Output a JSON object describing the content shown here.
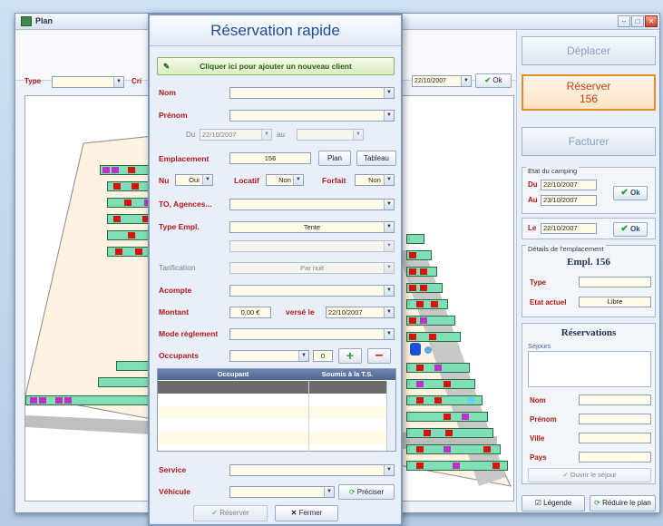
{
  "window": {
    "title": "Plan"
  },
  "toolbar": {
    "type_label": "Type",
    "crit_label": "Cri",
    "date_value": "22/10/2007",
    "ok_label": "Ok"
  },
  "right_panel": {
    "deplacer": "Déplacer",
    "reserver_line1": "Réserver",
    "reserver_line2": "156",
    "facturer": "Facturer",
    "etat_title": "Etat du camping",
    "du_label": "Du",
    "du_value": "22/10/2007",
    "au_label": "Au",
    "au_value": "23/10/2007",
    "ok_label": "Ok",
    "le_label": "Le",
    "le_value": "22/10/2007",
    "details_title": "Détails de l'emplacement",
    "empl_title": "Empl. 156",
    "type_label": "Type",
    "etat_actuel_label": "Etat actuel",
    "etat_actuel_value": "Libre",
    "reservations_title": "Réservations",
    "sejours_label": "Séjours",
    "nom_label": "Nom",
    "prenom_label": "Prénom",
    "ville_label": "Ville",
    "pays_label": "Pays",
    "ouvrir_sejour": "Ouvrir le séjour",
    "legende": "Légende",
    "reduire_plan": "Réduire le plan"
  },
  "dialog": {
    "title": "Réservation rapide",
    "add_client": "Cliquer ici pour ajouter un nouveau client",
    "nom_label": "Nom",
    "prenom_label": "Prénom",
    "du_label": "Du",
    "du_value": "22/10/2007",
    "au_label": "au",
    "emplacement_label": "Emplacement",
    "emplacement_value": "156",
    "plan_btn": "Plan",
    "tableau_btn": "Tableau",
    "nu_label": "Nu",
    "nu_value": "Oui",
    "locatif_label": "Locatif",
    "locatif_value": "Non",
    "forfait_label": "Forfait",
    "forfait_value": "Non",
    "to_label": "TO, Agences...",
    "type_empl_label": "Type Empl.",
    "type_empl_value": "Tente",
    "tarification_label": "Tarification",
    "tarification_value": "Par nuit",
    "acompte_label": "Acompte",
    "montant_label": "Montant",
    "montant_value": "0,00 €",
    "verse_label": "versé le",
    "verse_value": "22/10/2007",
    "mode_label": "Mode règlement",
    "occupants_label": "Occupants",
    "occupants_count": "0",
    "col_occupant": "Occupant",
    "col_soumis": "Soumis à la T.S.",
    "service_label": "Service",
    "vehicule_label": "Véhicule",
    "preciser_btn": "Préciser",
    "reserver_btn": "Réserver",
    "fermer_btn": "Fermer"
  },
  "colors": {
    "accent_blue": "#1f4b9a",
    "label_red": "#b01818",
    "site_green": "#7fe0b8",
    "occupied_red": "#d81111",
    "reserve_orange": "#e38c2f"
  }
}
